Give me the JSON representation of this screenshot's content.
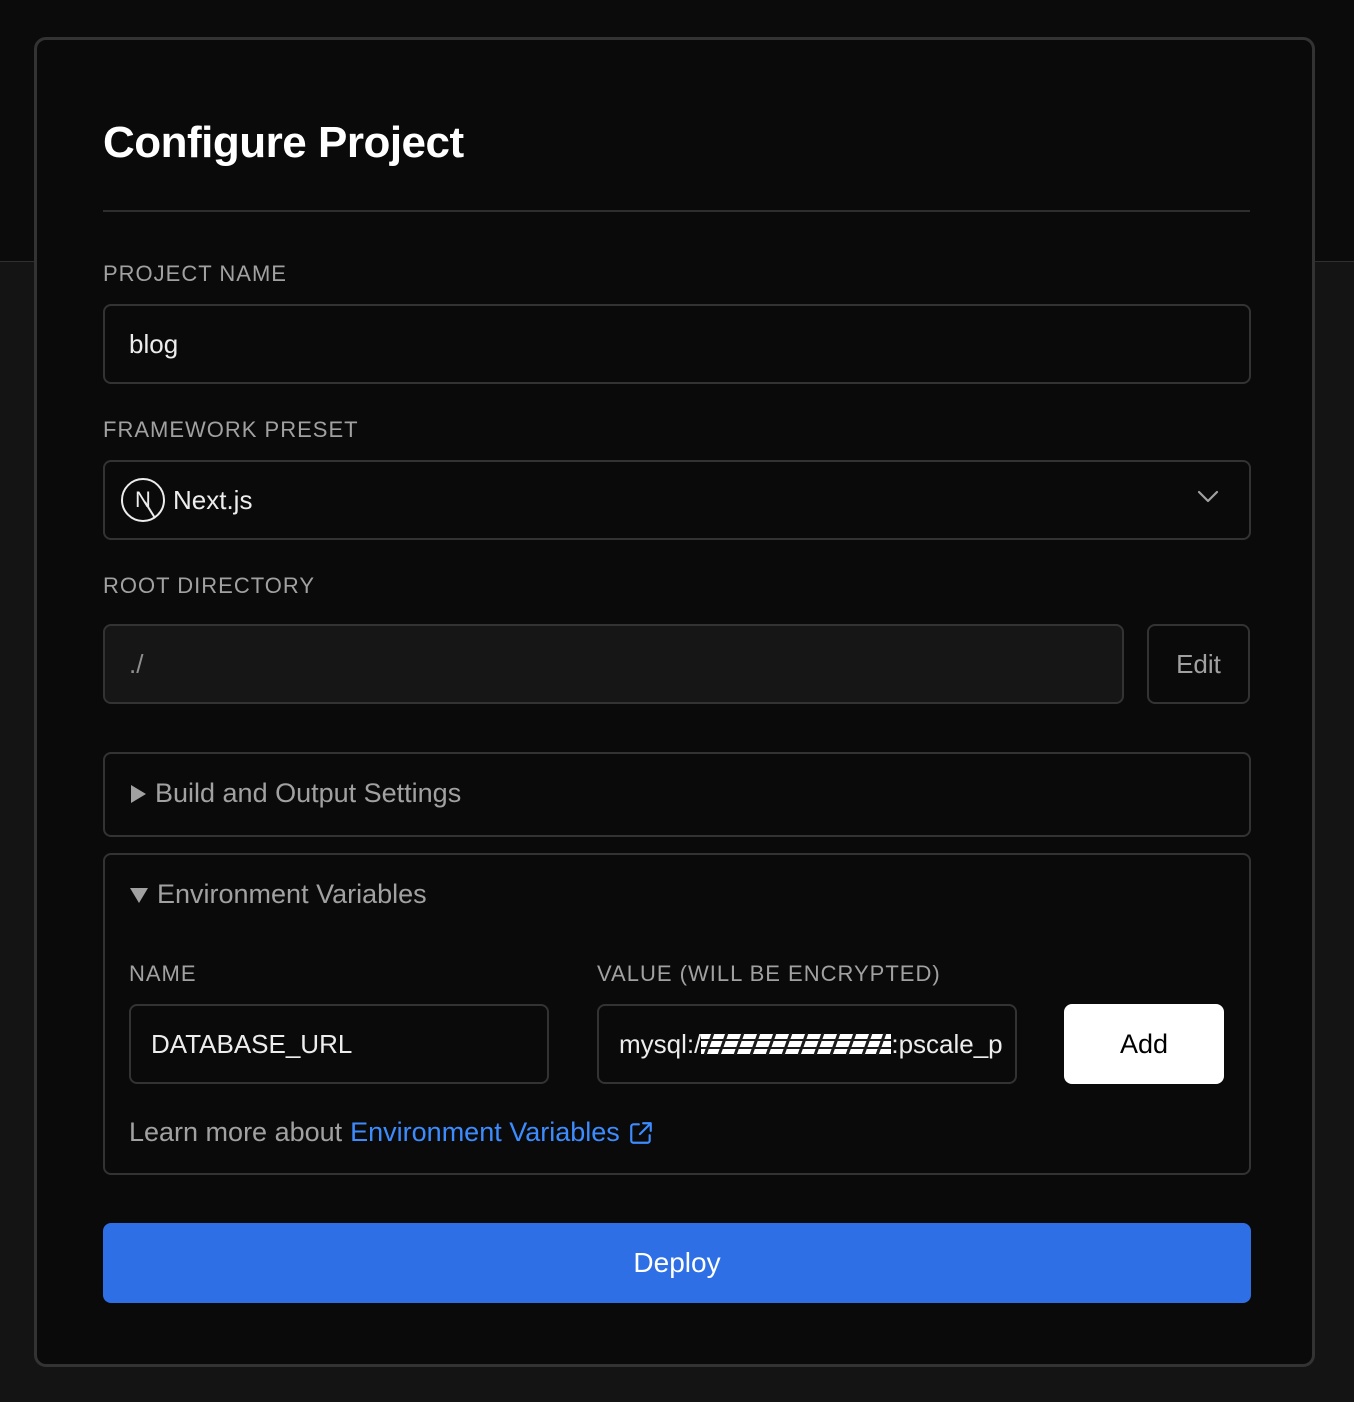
{
  "page": {
    "title": "Configure Project"
  },
  "project_name": {
    "label": "PROJECT NAME",
    "value": "blog"
  },
  "framework_preset": {
    "label": "FRAMEWORK PRESET",
    "icon_letter": "N",
    "icon": "nextjs-logo-icon",
    "value": "Next.js",
    "dropdown_icon": "chevron-down-icon"
  },
  "root_directory": {
    "label": "ROOT DIRECTORY",
    "value": "./",
    "edit_label": "Edit"
  },
  "build_settings": {
    "title": "Build and Output Settings",
    "expanded": false
  },
  "env_vars": {
    "title": "Environment Variables",
    "expanded": true,
    "name_label": "NAME",
    "value_label": "VALUE (WILL BE ENCRYPTED)",
    "name_value": "DATABASE_URL",
    "value_prefix": "mysql:/",
    "value_suffix": ":pscale_p",
    "add_label": "Add",
    "learn_text": "Learn more about",
    "learn_link": "Environment Variables",
    "link_icon": "external-link-icon"
  },
  "deploy": {
    "label": "Deploy"
  },
  "colors": {
    "accent": "#2e6fe5",
    "link": "#3d8cff",
    "background": "#0a0a0a",
    "border": "#333333"
  }
}
